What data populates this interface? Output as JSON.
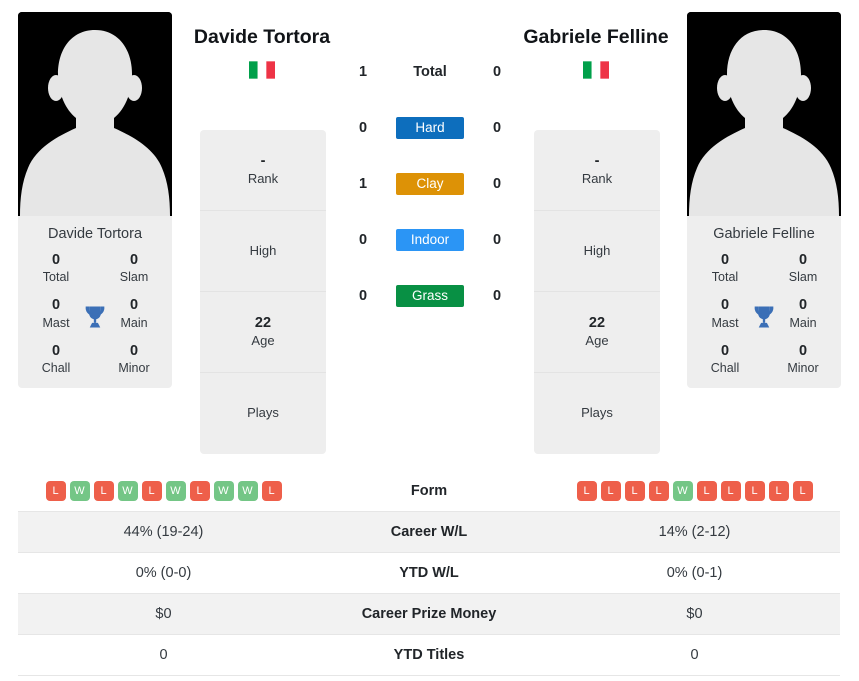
{
  "players": {
    "left": {
      "name": "Davide Tortora",
      "card_name": "Davide Tortora",
      "flag": "italy-flag",
      "titles": {
        "total": "0",
        "total_label": "Total",
        "slam": "0",
        "slam_label": "Slam",
        "mast": "0",
        "mast_label": "Mast",
        "main": "0",
        "main_label": "Main",
        "chall": "0",
        "chall_label": "Chall",
        "minor": "0",
        "minor_label": "Minor"
      },
      "info": {
        "rank_value": "-",
        "rank_label": "Rank",
        "high_value": "",
        "high_label": "High",
        "age_value": "22",
        "age_label": "Age",
        "plays_value": "",
        "plays_label": "Plays"
      },
      "form": [
        "L",
        "W",
        "L",
        "W",
        "L",
        "W",
        "L",
        "W",
        "W",
        "L"
      ],
      "career_wl": "44% (19-24)",
      "ytd_wl": "0% (0-0)",
      "career_prize_money": "$0",
      "ytd_titles": "0",
      "surface_scores": {
        "total": "1",
        "hard": "0",
        "clay": "1",
        "indoor": "0",
        "grass": "0"
      }
    },
    "right": {
      "name": "Gabriele Felline",
      "card_name": "Gabriele Felline",
      "flag": "italy-flag",
      "titles": {
        "total": "0",
        "total_label": "Total",
        "slam": "0",
        "slam_label": "Slam",
        "mast": "0",
        "mast_label": "Mast",
        "main": "0",
        "main_label": "Main",
        "chall": "0",
        "chall_label": "Chall",
        "minor": "0",
        "minor_label": "Minor"
      },
      "info": {
        "rank_value": "-",
        "rank_label": "Rank",
        "high_value": "",
        "high_label": "High",
        "age_value": "22",
        "age_label": "Age",
        "plays_value": "",
        "plays_label": "Plays"
      },
      "form": [
        "L",
        "L",
        "L",
        "L",
        "W",
        "L",
        "L",
        "L",
        "L",
        "L"
      ],
      "career_wl": "14% (2-12)",
      "ytd_wl": "0% (0-1)",
      "career_prize_money": "$0",
      "ytd_titles": "0",
      "surface_scores": {
        "total": "0",
        "hard": "0",
        "clay": "0",
        "indoor": "0",
        "grass": "0"
      }
    }
  },
  "surfaces": [
    {
      "key": "total",
      "label": "Total",
      "styled": false,
      "color": ""
    },
    {
      "key": "hard",
      "label": "Hard",
      "styled": true,
      "color": "#0d6ebd"
    },
    {
      "key": "clay",
      "label": "Clay",
      "styled": true,
      "color": "#dd9206"
    },
    {
      "key": "indoor",
      "label": "Indoor",
      "styled": true,
      "color": "#2b95f5"
    },
    {
      "key": "grass",
      "label": "Grass",
      "styled": true,
      "color": "#089044"
    }
  ],
  "comparison_rows": [
    {
      "label": "Form",
      "type": "form"
    },
    {
      "label": "Career W/L",
      "type": "text",
      "field": "career_wl"
    },
    {
      "label": "YTD W/L",
      "type": "text",
      "field": "ytd_wl"
    },
    {
      "label": "Career Prize Money",
      "type": "text",
      "field": "career_prize_money"
    },
    {
      "label": "YTD Titles",
      "type": "text",
      "field": "ytd_titles"
    }
  ],
  "colors": {
    "hard": "#0d6ebd",
    "clay": "#dd9206",
    "indoor": "#2b95f5",
    "grass": "#089044",
    "win_badge": "#74c686",
    "loss_badge": "#ee5f4a",
    "trophy": "#3b6fb6",
    "card_bg": "#eeeeee",
    "row_shade": "#f2f2f2"
  }
}
